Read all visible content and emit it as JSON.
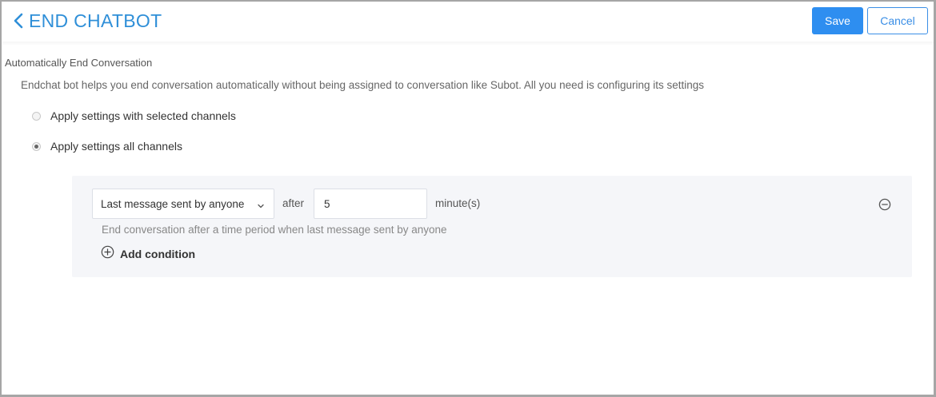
{
  "header": {
    "title": "END CHATBOT",
    "back_icon": "chevron-left-icon",
    "save_label": "Save",
    "cancel_label": "Cancel"
  },
  "section": {
    "title": "Automatically End Conversation",
    "description": "Endchat bot helps you end conversation automatically without being assigned to conversation like Subot. All you need is configuring its settings"
  },
  "channel_options": [
    {
      "label": "Apply settings with selected channels",
      "selected": false
    },
    {
      "label": "Apply settings all channels",
      "selected": true
    }
  ],
  "condition": {
    "trigger_value": "Last message sent by anyone",
    "after_label": "after",
    "minutes_value": "5",
    "unit_label": "minute(s)",
    "description": "End conversation after a time period when last message sent by anyone",
    "add_condition_label": "Add condition"
  },
  "colors": {
    "accent": "#2e8ef0",
    "title_blue": "#2f8fd8",
    "panel_bg": "#f5f6f9"
  }
}
